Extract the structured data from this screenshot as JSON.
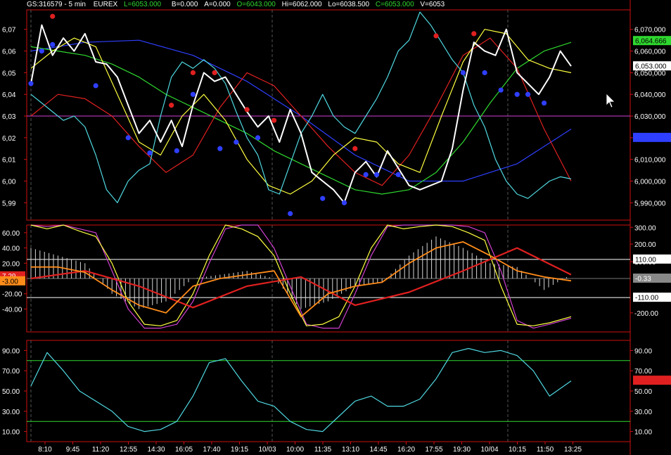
{
  "header": {
    "symbol": "GS:316579 - 5 min",
    "exchange": "EUREX",
    "last": "L=6053.000",
    "bid": "B=0.000",
    "ask": "A=0.000",
    "open": "O=6043.000",
    "high": "Hi=6062.000",
    "low": "Lo=6038.500",
    "close": "C=6053.000",
    "volume": "V=6053"
  },
  "colors": {
    "price": "#ffffff",
    "cyan": "#4fd8e0",
    "yellow": "#ffff40",
    "green": "#2fd82f",
    "blue": "#2f3fff",
    "red": "#e02020",
    "magenta": "#d040d0",
    "orange": "#ff8c1a",
    "grid": "#9a1010",
    "axis": "#cc1111"
  },
  "x_labels": [
    "8:10",
    "9:45",
    "11:20",
    "12:55",
    "14:30",
    "16:05",
    "17:40",
    "19:15",
    "10/03",
    "10:00",
    "11:35",
    "13:10",
    "14:45",
    "16:20",
    "17:55",
    "19:30",
    "10/04",
    "10:15",
    "11:50",
    "13:25"
  ],
  "panels": {
    "price": {
      "left_ticks": [
        "6,07",
        "6,06",
        "6,05",
        "6,04",
        "6,03",
        "6,02",
        "6,01",
        "6,00",
        "5,99"
      ],
      "right_ticks": [
        "6,070,000",
        "6,060,000",
        "6,050,000",
        "6,040,000",
        "6,030,000",
        "6,020,000",
        "6,010,000",
        "6,000,000",
        "5,990,000"
      ],
      "tags": [
        {
          "label": "6,064.666",
          "bg": "#2fd82f",
          "fg": "#000000"
        },
        {
          "label": "6,053.000",
          "bg": "#ffffff",
          "fg": "#000000"
        },
        {
          "label": "6,020.000",
          "bg": "#2f3fff",
          "fg": "#2f3fff"
        }
      ]
    },
    "oscillator": {
      "left_ticks": [
        "60.00",
        "40.00",
        "20.00",
        "-20.00",
        "-40.00"
      ],
      "right_ticks": [
        "300.00",
        "200.00",
        "100.00",
        "-200.00"
      ],
      "left_tags": [
        {
          "label": "7.29",
          "bg": "#e02020",
          "fg": "#ffffff"
        },
        {
          "label": "-3.00",
          "bg": "#ff8c1a",
          "fg": "#000000"
        }
      ],
      "right_tags": [
        {
          "label": "110.00",
          "bg": "#ffffff",
          "fg": "#000000"
        },
        {
          "label": "-0.33",
          "bg": "#888888",
          "fg": "#ffffff"
        },
        {
          "label": "-110.00",
          "bg": "#ffffff",
          "fg": "#000000"
        }
      ]
    },
    "rsi": {
      "left_ticks": [
        "90.00",
        "70.00",
        "50.00",
        "30.00",
        "10.00"
      ],
      "right_ticks": [
        "90.00",
        "70.00",
        "50.00",
        "30.00",
        "10.00"
      ],
      "tags": [
        {
          "label": "60.33",
          "bg": "#e02020",
          "fg": "#e02020"
        }
      ]
    }
  },
  "chart_data": [
    {
      "type": "line",
      "panel": "price",
      "ylim": [
        5982,
        6079
      ],
      "reference_line": 6030,
      "series": [
        {
          "key": "close",
          "color": "#ffffff",
          "x": [
            0,
            2,
            4,
            6,
            8,
            10,
            12,
            14,
            16,
            18,
            20,
            22,
            24,
            26,
            28,
            30,
            32,
            34,
            36,
            38,
            40,
            42,
            44,
            46,
            48,
            50,
            52,
            54,
            56,
            58,
            60,
            62,
            64,
            66,
            68,
            70,
            72,
            74,
            76,
            78,
            80,
            82,
            84,
            86,
            88,
            90,
            92,
            94,
            96,
            98,
            100
          ],
          "y": [
            6045,
            6072,
            6058,
            6066,
            6060,
            6068,
            6055,
            6054,
            6048,
            6035,
            6022,
            6028,
            6018,
            6028,
            6016,
            6035,
            6050,
            6046,
            6048,
            6040,
            6032,
            6025,
            6030,
            6018,
            6033,
            6022,
            6004,
            6000,
            5996,
            5990,
            6004,
            6009,
            6002,
            6014,
            6006,
            5998,
            5996,
            5998,
            6000,
            6015,
            6042,
            6064,
            6060,
            6058,
            6070,
            6050,
            6045,
            6040,
            6048,
            6060,
            6053
          ]
        },
        {
          "key": "cyan",
          "color": "#4fd8e0",
          "x": [
            0,
            2,
            4,
            6,
            8,
            10,
            12,
            14,
            16,
            18,
            20,
            22,
            24,
            26,
            28,
            30,
            32,
            34,
            36,
            38,
            40,
            42,
            44,
            46,
            48,
            50,
            52,
            54,
            56,
            58,
            60,
            62,
            64,
            66,
            68,
            70,
            72,
            74,
            76,
            78,
            80,
            82,
            84,
            86,
            88,
            90,
            92,
            94,
            96,
            98,
            100
          ],
          "y": [
            6040,
            6036,
            6032,
            6028,
            6030,
            6025,
            6012,
            5996,
            5990,
            6000,
            6005,
            6008,
            6030,
            6048,
            6055,
            6052,
            6056,
            6052,
            6045,
            6032,
            6020,
            6012,
            5996,
            5994,
            6008,
            6022,
            6030,
            6040,
            6030,
            6025,
            6022,
            6030,
            6038,
            6048,
            6060,
            6065,
            6078,
            6072,
            6064,
            6056,
            6050,
            6035,
            6025,
            6010,
            6000,
            5994,
            5992,
            5996,
            6000,
            6002,
            6001
          ]
        },
        {
          "key": "yellow",
          "color": "#ffff40",
          "x": [
            0,
            4,
            8,
            12,
            16,
            20,
            24,
            28,
            32,
            36,
            40,
            44,
            48,
            52,
            56,
            60,
            64,
            68,
            72,
            76,
            80,
            84,
            88,
            92,
            96,
            100
          ],
          "y": [
            6052,
            6060,
            6066,
            6062,
            6040,
            6018,
            6012,
            6030,
            6040,
            6028,
            6010,
            5998,
            5994,
            6000,
            6012,
            6020,
            6018,
            6008,
            6004,
            6030,
            6055,
            6070,
            6068,
            6056,
            6052,
            6050
          ]
        },
        {
          "key": "green",
          "color": "#2fd82f",
          "x": [
            0,
            5,
            10,
            15,
            20,
            25,
            30,
            35,
            40,
            45,
            50,
            55,
            60,
            65,
            70,
            75,
            80,
            85,
            90,
            95,
            100
          ],
          "y": [
            6062,
            6060,
            6058,
            6054,
            6048,
            6040,
            6034,
            6028,
            6022,
            6014,
            6008,
            6002,
            5996,
            5994,
            5996,
            6004,
            6018,
            6036,
            6052,
            6060,
            6064
          ]
        },
        {
          "key": "blue",
          "color": "#2f3fff",
          "x": [
            0,
            10,
            20,
            30,
            40,
            50,
            60,
            70,
            80,
            90,
            100
          ],
          "y": [
            6060,
            6064,
            6065,
            6058,
            6046,
            6030,
            6012,
            6000,
            6000,
            6008,
            6024
          ]
        },
        {
          "key": "red",
          "color": "#e02020",
          "x": [
            0,
            5,
            10,
            15,
            20,
            25,
            30,
            35,
            40,
            45,
            50,
            55,
            60,
            65,
            70,
            75,
            80,
            85,
            90,
            95,
            100
          ],
          "y": [
            6030,
            6040,
            6038,
            6030,
            6016,
            6004,
            6012,
            6034,
            6050,
            6044,
            6030,
            6016,
            6004,
            5998,
            6012,
            6034,
            6058,
            6066,
            6052,
            6024,
            6000
          ]
        }
      ],
      "markers": {
        "red": {
          "x": [
            4,
            26,
            30,
            34,
            40,
            45,
            60,
            75,
            82
          ],
          "y": [
            6076,
            6035,
            6050,
            6050,
            6033,
            6028,
            6015,
            6067,
            6068
          ]
        },
        "blue": {
          "x": [
            0,
            2,
            4,
            12,
            18,
            22,
            27,
            30,
            35,
            38,
            42,
            48,
            54,
            58,
            62,
            64,
            68,
            80,
            84,
            87,
            90,
            92,
            95
          ],
          "y": [
            6045,
            6060,
            6063,
            6044,
            6020,
            6013,
            6014,
            6040,
            6015,
            6018,
            6020,
            5985,
            5992,
            5990,
            6003,
            6003,
            6003,
            6050,
            6050,
            6042,
            6040,
            6040,
            6036
          ]
        }
      }
    },
    {
      "type": "line",
      "panel": "oscillator",
      "ylim": [
        -70,
        70
      ],
      "reference_lines": [
        0,
        25,
        -25
      ],
      "series": [
        {
          "key": "magenta",
          "color": "#d040d0",
          "x": [
            0,
            3,
            6,
            9,
            12,
            15,
            18,
            21,
            24,
            27,
            30,
            33,
            36,
            39,
            42,
            45,
            48,
            51,
            54,
            57,
            60,
            63,
            66,
            69,
            72,
            75,
            78,
            81,
            84,
            87,
            90,
            93,
            96,
            100
          ],
          "y": [
            70,
            68,
            70,
            65,
            60,
            10,
            -40,
            -65,
            -65,
            -60,
            -30,
            20,
            65,
            70,
            70,
            40,
            -10,
            -60,
            -65,
            -65,
            -20,
            30,
            68,
            70,
            70,
            70,
            70,
            68,
            60,
            10,
            -55,
            -65,
            -60,
            -52
          ]
        },
        {
          "key": "yellow",
          "color": "#ffff40",
          "x": [
            0,
            3,
            6,
            9,
            12,
            15,
            18,
            21,
            24,
            27,
            30,
            33,
            36,
            39,
            42,
            45,
            48,
            51,
            54,
            57,
            60,
            63,
            66,
            69,
            72,
            75,
            78,
            81,
            84,
            87,
            90,
            93,
            96,
            100
          ],
          "y": [
            70,
            65,
            70,
            62,
            55,
            20,
            -30,
            -60,
            -62,
            -55,
            -20,
            30,
            70,
            65,
            55,
            30,
            -20,
            -62,
            -60,
            -50,
            -10,
            40,
            70,
            65,
            68,
            70,
            68,
            60,
            50,
            -10,
            -60,
            -62,
            -58,
            -50
          ]
        },
        {
          "key": "red",
          "color": "#e02020",
          "x": [
            0,
            10,
            20,
            30,
            40,
            50,
            60,
            70,
            80,
            90,
            100
          ],
          "y": [
            0,
            10,
            -10,
            -38,
            -10,
            2,
            -35,
            -18,
            10,
            40,
            5
          ]
        },
        {
          "key": "orange",
          "color": "#ff8c1a",
          "x": [
            0,
            5,
            10,
            15,
            20,
            25,
            30,
            35,
            40,
            45,
            50,
            55,
            60,
            65,
            70,
            75,
            80,
            85,
            90,
            95,
            100
          ],
          "y": [
            15,
            15,
            8,
            -15,
            -35,
            -45,
            -10,
            0,
            5,
            10,
            -50,
            -20,
            -10,
            -5,
            20,
            40,
            48,
            30,
            10,
            2,
            -3
          ]
        },
        {
          "key": "histogram",
          "color": "#d8d8d8",
          "x": [
            0,
            5,
            10,
            15,
            20,
            25,
            30,
            35,
            40,
            45,
            50,
            55,
            60,
            65,
            70,
            75,
            80,
            85,
            90,
            95,
            100
          ],
          "y": [
            40,
            30,
            20,
            -20,
            -40,
            -30,
            0,
            5,
            10,
            0,
            -40,
            -30,
            -10,
            -5,
            30,
            55,
            40,
            20,
            15,
            -15,
            5
          ]
        }
      ]
    },
    {
      "type": "line",
      "panel": "rsi",
      "ylim": [
        0,
        100
      ],
      "reference_lines": [
        80,
        20
      ],
      "series": [
        {
          "key": "rsi",
          "color": "#4fd8e0",
          "x": [
            0,
            3,
            6,
            9,
            12,
            15,
            18,
            21,
            24,
            27,
            30,
            33,
            36,
            39,
            42,
            45,
            48,
            51,
            54,
            57,
            60,
            63,
            66,
            69,
            72,
            75,
            78,
            81,
            84,
            87,
            90,
            93,
            96,
            100
          ],
          "y": [
            55,
            88,
            70,
            50,
            40,
            30,
            15,
            10,
            12,
            20,
            45,
            78,
            82,
            60,
            40,
            35,
            20,
            12,
            10,
            25,
            40,
            45,
            35,
            35,
            42,
            62,
            88,
            92,
            88,
            90,
            85,
            70,
            45,
            60
          ]
        }
      ]
    }
  ]
}
